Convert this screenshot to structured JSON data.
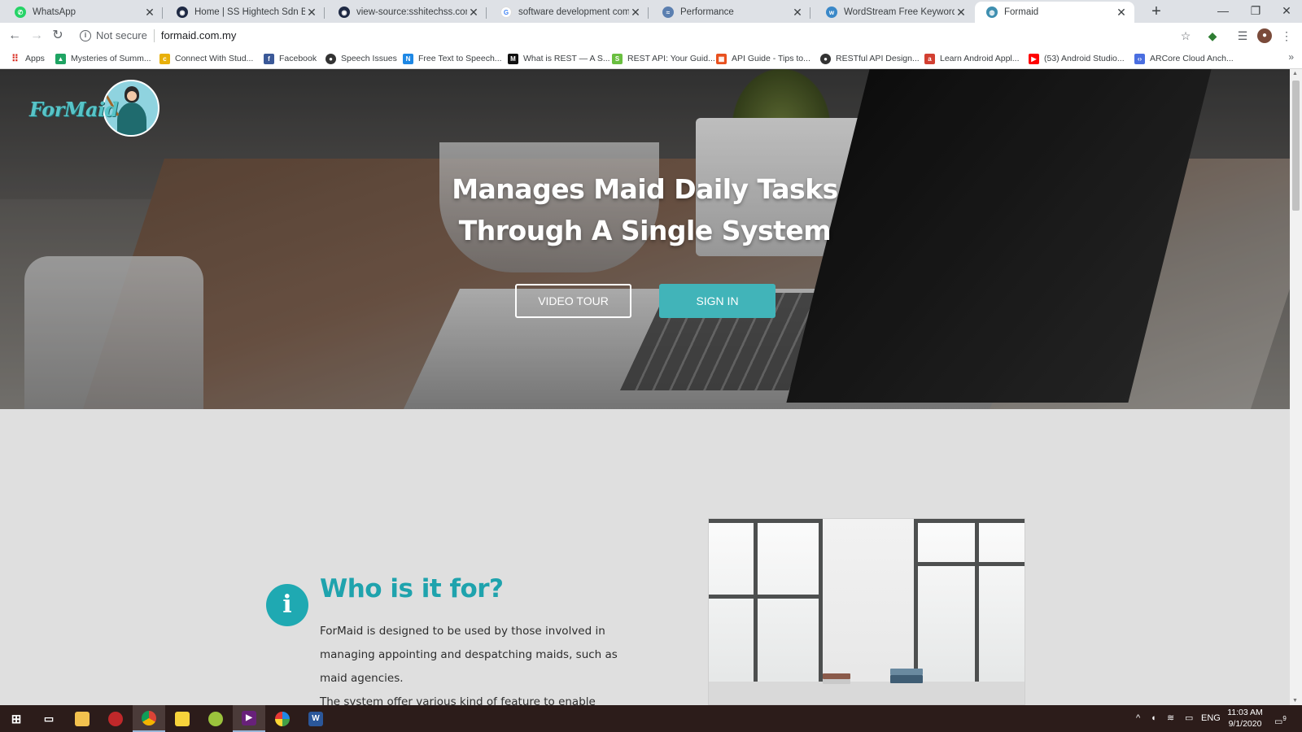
{
  "browser": {
    "tabs": [
      {
        "title": "WhatsApp",
        "icon": "whatsapp-icon",
        "color": "#25d366",
        "active": false
      },
      {
        "title": "Home | SS Hightech Sdn Bhd",
        "icon": "site-icon",
        "color": "#1f2a44",
        "active": false
      },
      {
        "title": "view-source:sshitechss.com/inde",
        "icon": "site-icon",
        "color": "#1f2a44",
        "active": false
      },
      {
        "title": "software development company",
        "icon": "google-icon",
        "color": "#4285f4",
        "active": false
      },
      {
        "title": "Performance",
        "icon": "performance-icon",
        "color": "#5b7fb0",
        "active": false
      },
      {
        "title": "WordStream Free Keyword Tool",
        "icon": "wordstream-icon",
        "color": "#3a88c8",
        "active": false
      },
      {
        "title": "Formaid",
        "icon": "globe-icon",
        "color": "#3f8fb0",
        "active": true
      }
    ],
    "new_tab": "+",
    "window_controls": {
      "minimize": "—",
      "restore": "❐",
      "close": "✕"
    },
    "omnibox": {
      "security": "Not secure",
      "url": "formaid.com.my"
    },
    "bookmarks": [
      {
        "label": "Apps",
        "icon": "apps-grid-icon",
        "color": "#d93025"
      },
      {
        "label": "Mysteries of Summ...",
        "icon": "drive-icon",
        "color": "#1fa463"
      },
      {
        "label": "Connect With Stud...",
        "icon": "c-icon",
        "color": "#e8b00a"
      },
      {
        "label": "Facebook",
        "icon": "facebook-icon",
        "color": "#3b5998"
      },
      {
        "label": "Speech Issues",
        "icon": "github-icon",
        "color": "#333333"
      },
      {
        "label": "Free Text to Speech...",
        "icon": "n-icon",
        "color": "#1e88e5"
      },
      {
        "label": "What is REST — A S...",
        "icon": "medium-icon",
        "color": "#111111"
      },
      {
        "label": "REST API: Your Guid...",
        "icon": "s-icon",
        "color": "#6abf40"
      },
      {
        "label": "API Guide - Tips to...",
        "icon": "api-icon",
        "color": "#e8501e"
      },
      {
        "label": "RESTful API Design...",
        "icon": "github-icon",
        "color": "#333333"
      },
      {
        "label": "Learn Android Appl...",
        "icon": "a-icon",
        "color": "#d23f31"
      },
      {
        "label": "(53) Android Studio...",
        "icon": "youtube-icon",
        "color": "#ff0000"
      },
      {
        "label": "ARCore Cloud Anch...",
        "icon": "code-icon",
        "color": "#4a6ee0"
      }
    ],
    "bookmarks_more": "»"
  },
  "page": {
    "logo_text": "ForMaid",
    "hero": {
      "title_line1": "Manages Maid Daily Tasks",
      "title_line2": "Through A Single System",
      "btn_tour": "VIDEO TOUR",
      "btn_signin": "SIGN IN"
    },
    "about": {
      "icon_glyph": "i",
      "title": "Who is it for?",
      "p1": "ForMaid is designed to be used by those involved in managing appointing and despatching maids, such as maid agencies.",
      "p2": "The system offer various kind of feature to enable"
    },
    "accent_color": "#1fa3ad"
  },
  "taskbar": {
    "apps": [
      "windows-start-icon",
      "task-view-icon",
      "file-explorer-icon",
      "app-red-icon",
      "chrome-icon",
      "sticky-notes-icon",
      "android-app-icon",
      "visual-studio-icon",
      "photos-icon",
      "word-icon"
    ],
    "language": "ENG",
    "time": "11:03 AM",
    "date": "9/1/2020",
    "notification_count": "9"
  }
}
